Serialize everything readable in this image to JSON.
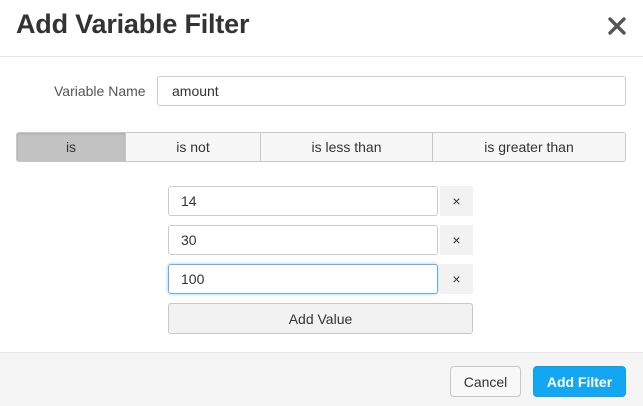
{
  "dialog": {
    "title": "Add Variable Filter",
    "close_icon": "close-icon"
  },
  "variable": {
    "label": "Variable Name",
    "value": "amount"
  },
  "operators": [
    {
      "label": "is",
      "selected": true
    },
    {
      "label": "is not",
      "selected": false
    },
    {
      "label": "is less than",
      "selected": false
    },
    {
      "label": "is greater than",
      "selected": false
    }
  ],
  "values": [
    {
      "value": "14",
      "remove_label": "×"
    },
    {
      "value": "30",
      "remove_label": "×"
    },
    {
      "value": "100",
      "remove_label": "×",
      "focused": true
    }
  ],
  "add_value_label": "Add Value",
  "footer": {
    "cancel_label": "Cancel",
    "submit_label": "Add Filter"
  },
  "colors": {
    "accent": "#13a6f2",
    "selected_operator": "#c2c2c2",
    "focus_ring": "#66afe9"
  }
}
